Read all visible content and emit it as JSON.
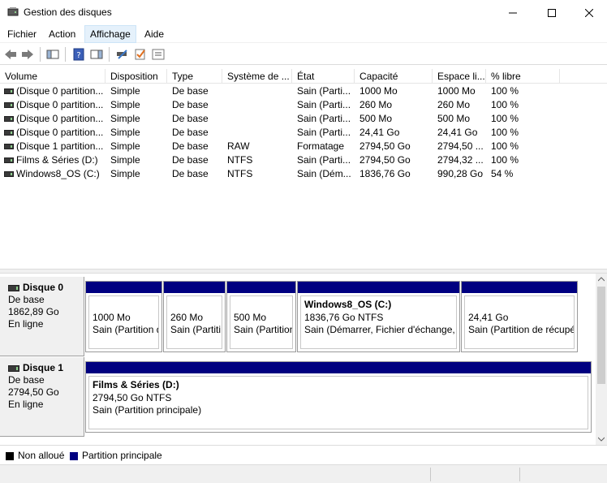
{
  "window": {
    "title": "Gestion des disques"
  },
  "menu": [
    {
      "label": "Fichier"
    },
    {
      "label": "Action"
    },
    {
      "label": "Affichage"
    },
    {
      "label": "Aide"
    }
  ],
  "volume_table": {
    "columns": [
      "Volume",
      "Disposition",
      "Type",
      "Système de ...",
      "État",
      "Capacité",
      "Espace li...",
      "% libre"
    ],
    "rows": [
      [
        "(Disque 0 partition...",
        "Simple",
        "De base",
        "",
        "Sain (Parti...",
        "1000 Mo",
        "1000 Mo",
        "100 %"
      ],
      [
        "(Disque 0 partition...",
        "Simple",
        "De base",
        "",
        "Sain (Parti...",
        "260 Mo",
        "260 Mo",
        "100 %"
      ],
      [
        "(Disque 0 partition...",
        "Simple",
        "De base",
        "",
        "Sain (Parti...",
        "500 Mo",
        "500 Mo",
        "100 %"
      ],
      [
        "(Disque 0 partition...",
        "Simple",
        "De base",
        "",
        "Sain (Parti...",
        "24,41 Go",
        "24,41 Go",
        "100 %"
      ],
      [
        "(Disque 1 partition...",
        "Simple",
        "De base",
        "RAW",
        "Formatage",
        "2794,50 Go",
        "2794,50 ...",
        "100 %"
      ],
      [
        "Films & Séries (D:)",
        "Simple",
        "De base",
        "NTFS",
        "Sain (Parti...",
        "2794,50 Go",
        "2794,32 ...",
        "100 %"
      ],
      [
        "Windows8_OS (C:)",
        "Simple",
        "De base",
        "NTFS",
        "Sain (Dém...",
        "1836,76 Go",
        "990,28 Go",
        "54 %"
      ]
    ]
  },
  "disks": [
    {
      "name": "Disque 0",
      "type": "De base",
      "size": "1862,89 Go",
      "status": "En ligne",
      "partitions": [
        {
          "title": "",
          "size": "1000 Mo",
          "status": "Sain (Partition d"
        },
        {
          "title": "",
          "size": "260 Mo",
          "status": "Sain (Partiti"
        },
        {
          "title": "",
          "size": "500 Mo",
          "status": "Sain (Partition"
        },
        {
          "title": "Windows8_OS  (C:)",
          "size": "1836,76 Go NTFS",
          "status": "Sain (Démarrer, Fichier d'échange, F"
        },
        {
          "title": "",
          "size": "24,41 Go",
          "status": "Sain (Partition de récupé"
        }
      ]
    },
    {
      "name": "Disque 1",
      "type": "De base",
      "size": "2794,50 Go",
      "status": "En ligne",
      "partitions": [
        {
          "title": "Films & Séries  (D:)",
          "size": "2794,50 Go NTFS",
          "status": "Sain (Partition principale)"
        }
      ]
    }
  ],
  "legend": [
    {
      "label": "Non alloué",
      "color": "#000000"
    },
    {
      "label": "Partition principale",
      "color": "#000080"
    }
  ],
  "colors": {
    "partition_stripe": "#000080",
    "menu_active": "#e5f1fb"
  }
}
